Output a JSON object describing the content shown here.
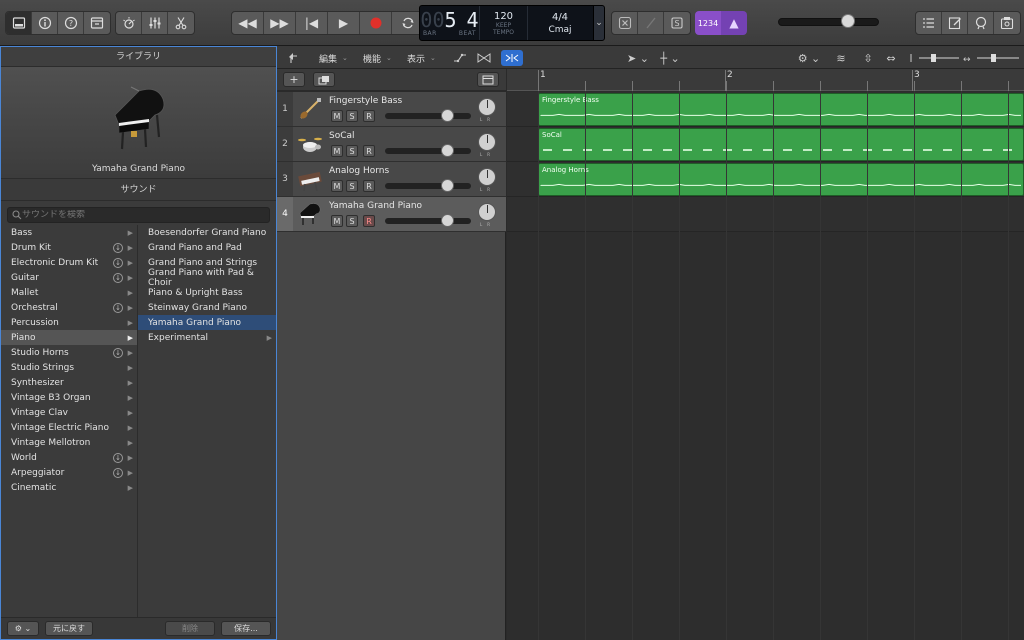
{
  "transport": {
    "bar_value": "5",
    "bar_dim": "00",
    "beat_value": "4",
    "bar_label": "BAR",
    "beat_label": "BEAT",
    "tempo_value": "120",
    "tempo_mode": "KEEP",
    "tempo_label": "TEMPO",
    "time_signature": "4/4",
    "key": "Cmaj",
    "count_in_label": "1234"
  },
  "library": {
    "title": "ライブラリ",
    "preview_name": "Yamaha Grand Piano",
    "sound_title": "サウンド",
    "search_placeholder": "サウンドを検索",
    "categories": [
      {
        "label": "Bass",
        "download": false
      },
      {
        "label": "Drum Kit",
        "download": true
      },
      {
        "label": "Electronic Drum Kit",
        "download": true
      },
      {
        "label": "Guitar",
        "download": true
      },
      {
        "label": "Mallet",
        "download": false
      },
      {
        "label": "Orchestral",
        "download": true
      },
      {
        "label": "Percussion",
        "download": false
      },
      {
        "label": "Piano",
        "download": false
      },
      {
        "label": "Studio Horns",
        "download": true
      },
      {
        "label": "Studio Strings",
        "download": false
      },
      {
        "label": "Synthesizer",
        "download": false
      },
      {
        "label": "Vintage B3 Organ",
        "download": false
      },
      {
        "label": "Vintage Clav",
        "download": false
      },
      {
        "label": "Vintage Electric Piano",
        "download": false
      },
      {
        "label": "Vintage Mellotron",
        "download": false
      },
      {
        "label": "World",
        "download": true
      },
      {
        "label": "Arpeggiator",
        "download": true
      },
      {
        "label": "Cinematic",
        "download": false
      }
    ],
    "selected_category_index": 7,
    "patches": [
      {
        "label": "Boesendorfer Grand Piano",
        "folder": false
      },
      {
        "label": "Grand Piano and Pad",
        "folder": false
      },
      {
        "label": "Grand Piano and Strings",
        "folder": false
      },
      {
        "label": "Grand Piano with Pad & Choir",
        "folder": false
      },
      {
        "label": "Piano & Upright Bass",
        "folder": false
      },
      {
        "label": "Steinway Grand Piano",
        "folder": false
      },
      {
        "label": "Yamaha Grand Piano",
        "folder": false
      },
      {
        "label": "Experimental",
        "folder": true
      }
    ],
    "selected_patch_index": 6,
    "footer": {
      "revert_label": "元に戻す",
      "delete_label": "削除",
      "save_label": "保存..."
    }
  },
  "menubar": {
    "edit_label": "編集",
    "functions_label": "機能",
    "view_label": "表示"
  },
  "tracks": [
    {
      "number": "1",
      "name": "Fingerstyle Bass",
      "icon": "bass-guitar-icon",
      "selected": false,
      "mute": "M",
      "solo": "S",
      "record": "R"
    },
    {
      "number": "2",
      "name": "SoCal",
      "icon": "drum-kit-icon",
      "selected": false,
      "mute": "M",
      "solo": "S",
      "record": "R"
    },
    {
      "number": "3",
      "name": "Analog Horns",
      "icon": "synth-keyboard-icon",
      "selected": false,
      "mute": "M",
      "solo": "S",
      "record": "R"
    },
    {
      "number": "4",
      "name": "Yamaha Grand Piano",
      "icon": "grand-piano-icon",
      "selected": true,
      "mute": "M",
      "solo": "S",
      "record": "R"
    }
  ],
  "ruler": {
    "bars": [
      "1",
      "2",
      "3"
    ]
  },
  "regions": [
    {
      "name": "Fingerstyle Bass",
      "style": "midi-line"
    },
    {
      "name": "SoCal",
      "style": "drummer-dashes"
    },
    {
      "name": "Analog Horns",
      "style": "midi-line"
    }
  ],
  "colors": {
    "region_green": "#3aa14a",
    "selection_blue": "#2e4d78",
    "record_red": "#e0302a",
    "count_in_purple": "#8a4fc9",
    "library_border": "#4a86d6"
  }
}
